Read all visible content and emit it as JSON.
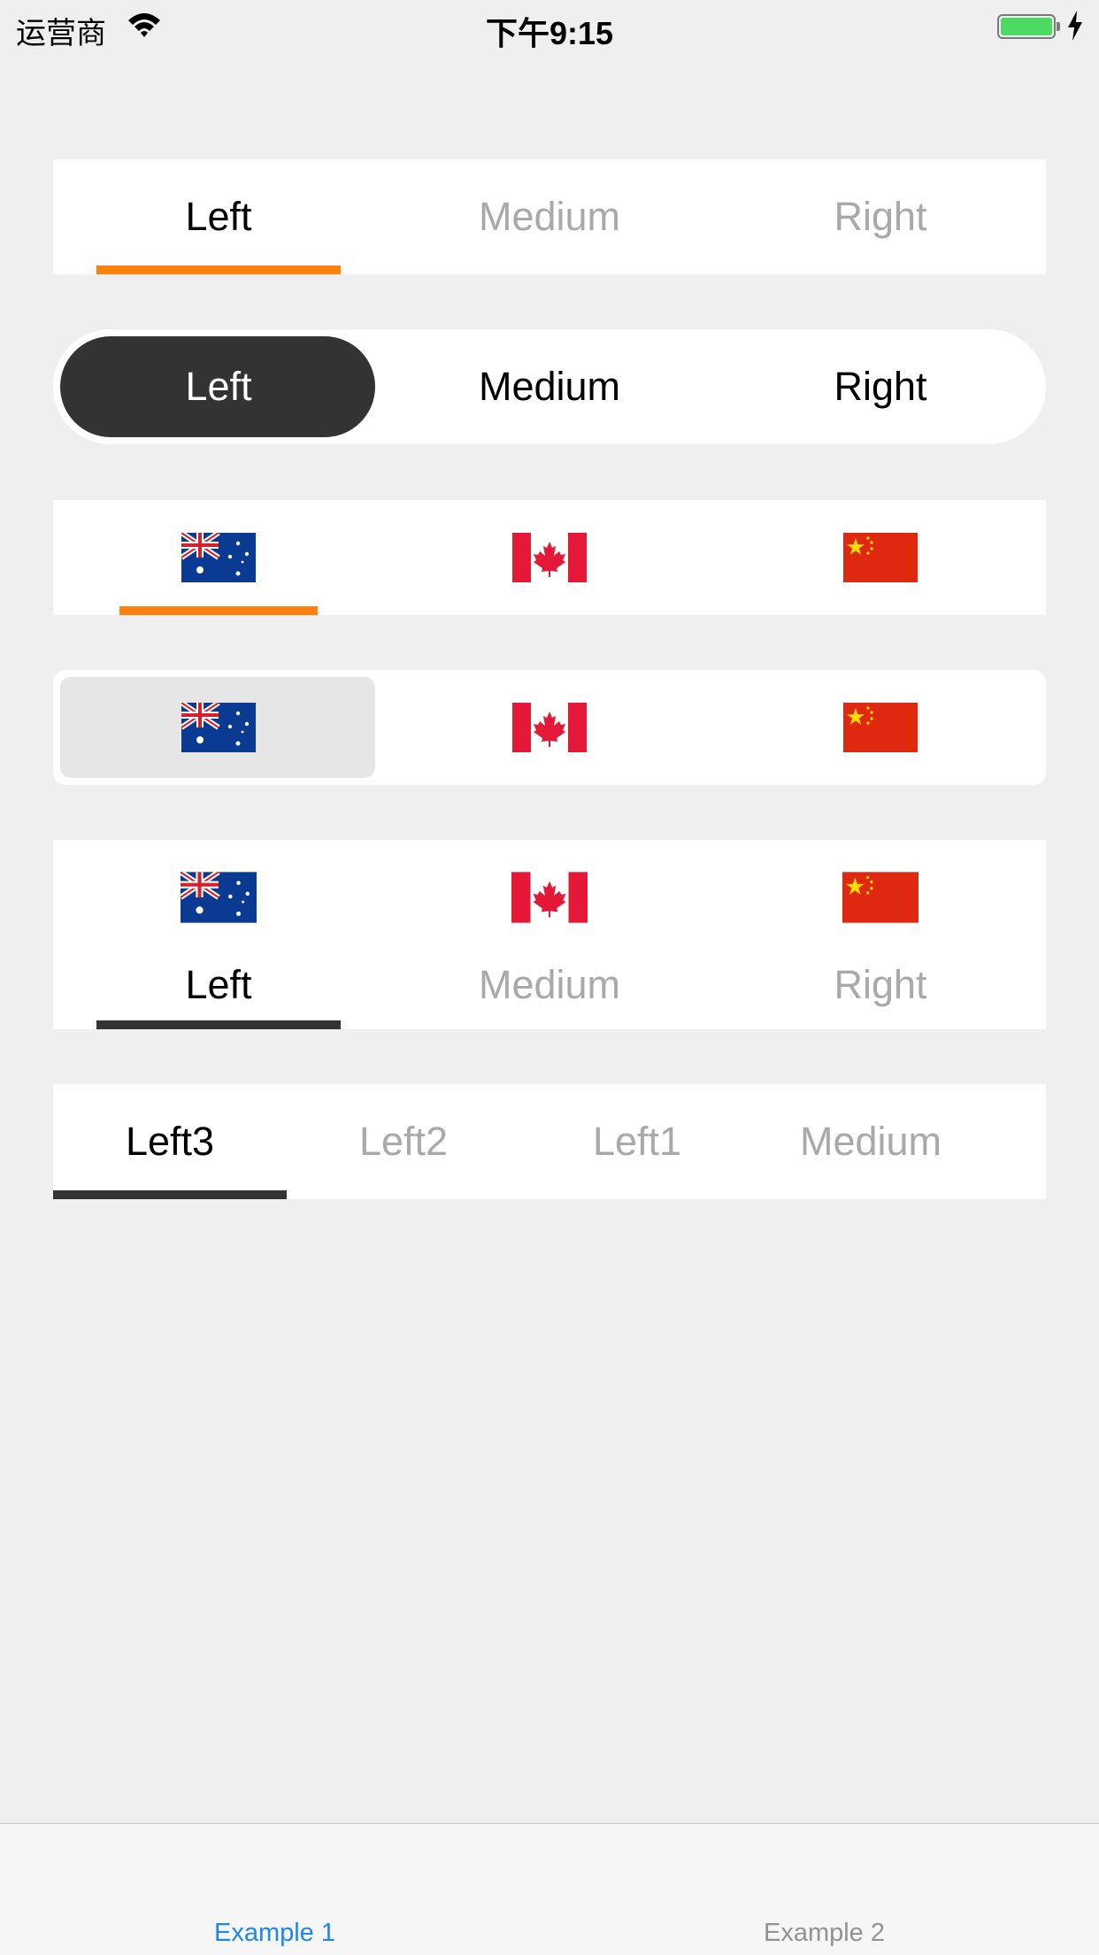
{
  "status_bar": {
    "carrier": "运营商",
    "time": "下午9:15"
  },
  "segments": {
    "text_underline": {
      "items": [
        "Left",
        "Medium",
        "Right"
      ],
      "selected": 0,
      "indicator_color": "#ff7f0f"
    },
    "pill": {
      "items": [
        "Left",
        "Medium",
        "Right"
      ],
      "selected": 0
    },
    "flags_underline": {
      "items": [
        "australia-flag",
        "canada-flag",
        "china-flag"
      ],
      "selected": 0,
      "indicator_color": "#ff7f0f"
    },
    "flags_box": {
      "items": [
        "australia-flag",
        "canada-flag",
        "china-flag"
      ],
      "selected": 0
    },
    "flags_text": {
      "labels": [
        "Left",
        "Medium",
        "Right"
      ],
      "selected": 0,
      "indicator_color": "#333333"
    },
    "scroll_tabs": {
      "items": [
        "Left3",
        "Left2",
        "Left1",
        "Medium"
      ],
      "selected": 0,
      "indicator_color": "#333333"
    }
  },
  "tab_bar": {
    "items": [
      "Example 1",
      "Example 2"
    ],
    "selected": 0,
    "accent": "#1f87e6"
  }
}
